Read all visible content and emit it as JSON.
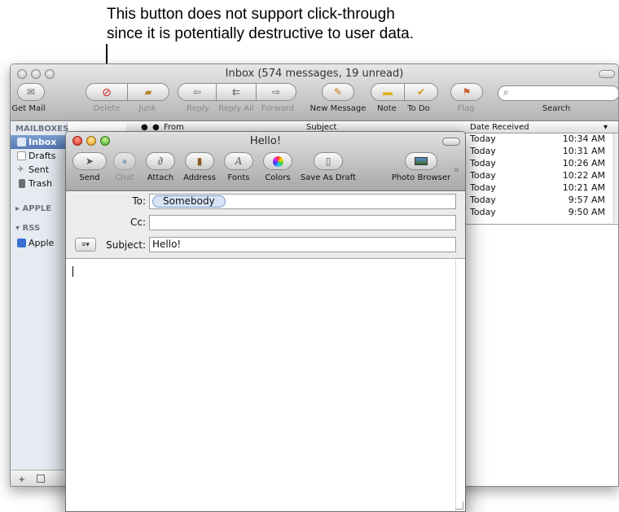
{
  "annotation": {
    "line1": "This button does not support click-through",
    "line2": "since it is potentially destructive to user data."
  },
  "mail": {
    "title": "Inbox (574 messages, 19 unread)",
    "toolbar": {
      "get_mail": "Get Mail",
      "delete": "Delete",
      "junk": "Junk",
      "reply": "Reply",
      "reply_all": "Reply All",
      "forward": "Forward",
      "new_message": "New Message",
      "note": "Note",
      "to_do": "To Do",
      "flag": "Flag",
      "search": "Search"
    },
    "sidebar": {
      "mailboxes_header": "MAILBOXES",
      "inbox": "Inbox",
      "drafts": "Drafts",
      "sent": "Sent",
      "trash": "Trash",
      "apple_header": "APPLE",
      "rss_header": "RSS",
      "apple_feed": "Apple",
      "add_button": "+"
    },
    "list": {
      "col_from": "From",
      "col_subject": "Subject",
      "col_date": "Date Received",
      "rows": [
        {
          "date": "Today",
          "time": "10:34 AM"
        },
        {
          "date": "Today",
          "time": "10:31 AM"
        },
        {
          "date": "Today",
          "time": "10:26 AM"
        },
        {
          "date": "Today",
          "time": "10:22 AM"
        },
        {
          "date": "Today",
          "time": "10:21 AM"
        },
        {
          "date": "Today",
          "time": "9:57 AM"
        },
        {
          "date": "Today",
          "time": "9:50 AM"
        }
      ]
    }
  },
  "compose": {
    "title": "Hello!",
    "toolbar": {
      "send": "Send",
      "chat": "Chat",
      "attach": "Attach",
      "address": "Address",
      "fonts": "Fonts",
      "colors": "Colors",
      "save_as_draft": "Save As Draft",
      "photo_browser": "Photo Browser"
    },
    "to_label": "To:",
    "to_value": "Somebody",
    "cc_label": "Cc:",
    "cc_value": "",
    "subject_label": "Subject:",
    "subject_value": "Hello!",
    "body": ""
  },
  "colors": {
    "selection": "#5578b4",
    "close": "#d52a1c",
    "minimize": "#e59d16",
    "zoom": "#45a81c",
    "token": "#d8e3f6"
  }
}
